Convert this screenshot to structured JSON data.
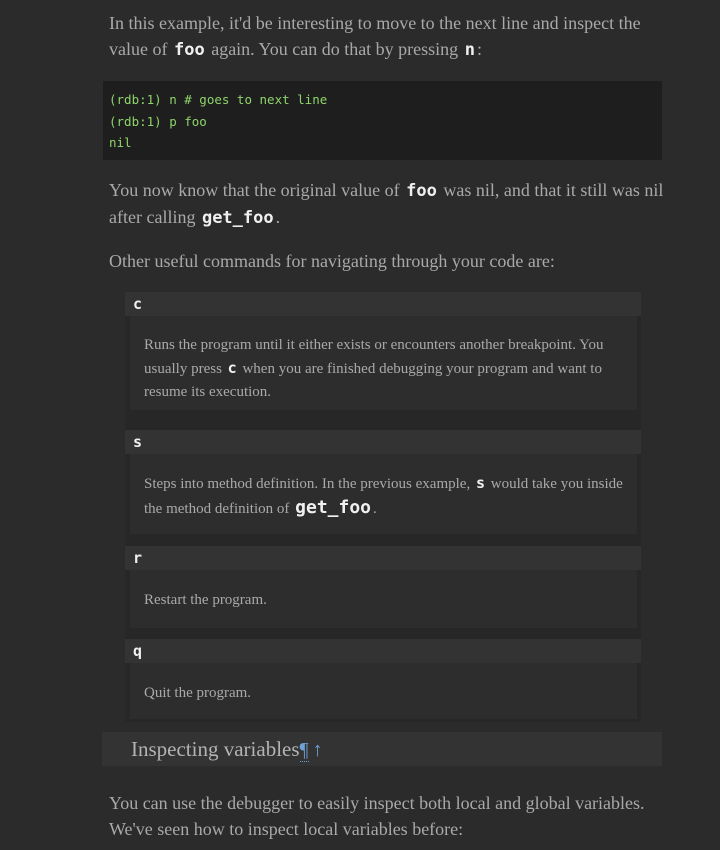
{
  "intro": {
    "text_before": "In this example, it'd be interesting to move to the next line and inspect the value of ",
    "code_foo": "foo",
    "text_middle": " again. You can do that by pressing ",
    "code_n": "n",
    "text_after": ":"
  },
  "code_block": {
    "lines": [
      "(rdb:1) n # goes to next line",
      "(rdb:1) p foo",
      "nil"
    ]
  },
  "paragraph2": {
    "text_before": "You now know that the original value of ",
    "code_foo": "foo",
    "text_middle": " was nil, and that it still was nil after calling ",
    "code_get_foo": "get_foo",
    "text_after": "."
  },
  "paragraph3": {
    "text": "Other useful commands for navigating through your code are:"
  },
  "commands": [
    {
      "term": "c",
      "desc_before": "Runs the program until it either exists or encounters another breakpoint. You usually press ",
      "desc_code": "c",
      "desc_after": " when you are finished debugging your program and want to resume its execution."
    },
    {
      "term": "s",
      "desc_before": "Steps into method definition. In the previous example, ",
      "desc_code": "s",
      "desc_middle": " would take you inside the method definition of ",
      "desc_code2": "get_foo",
      "desc_after": "."
    },
    {
      "term": "r",
      "desc": "Restart the program."
    },
    {
      "term": "q",
      "desc": "Quit the program."
    }
  ],
  "section_heading": {
    "title": "Inspecting variables",
    "anchor_glyph": "¶",
    "top_glyph": "↑"
  },
  "paragraph4": {
    "text": "You can use the debugger to easily inspect both local and global variables. We've seen how to inspect local variables before:"
  },
  "colors": {
    "background": "#2b2b2b",
    "text": "#a9a9a9",
    "code_green": "#8ed46a",
    "link": "#6fa0d8"
  }
}
